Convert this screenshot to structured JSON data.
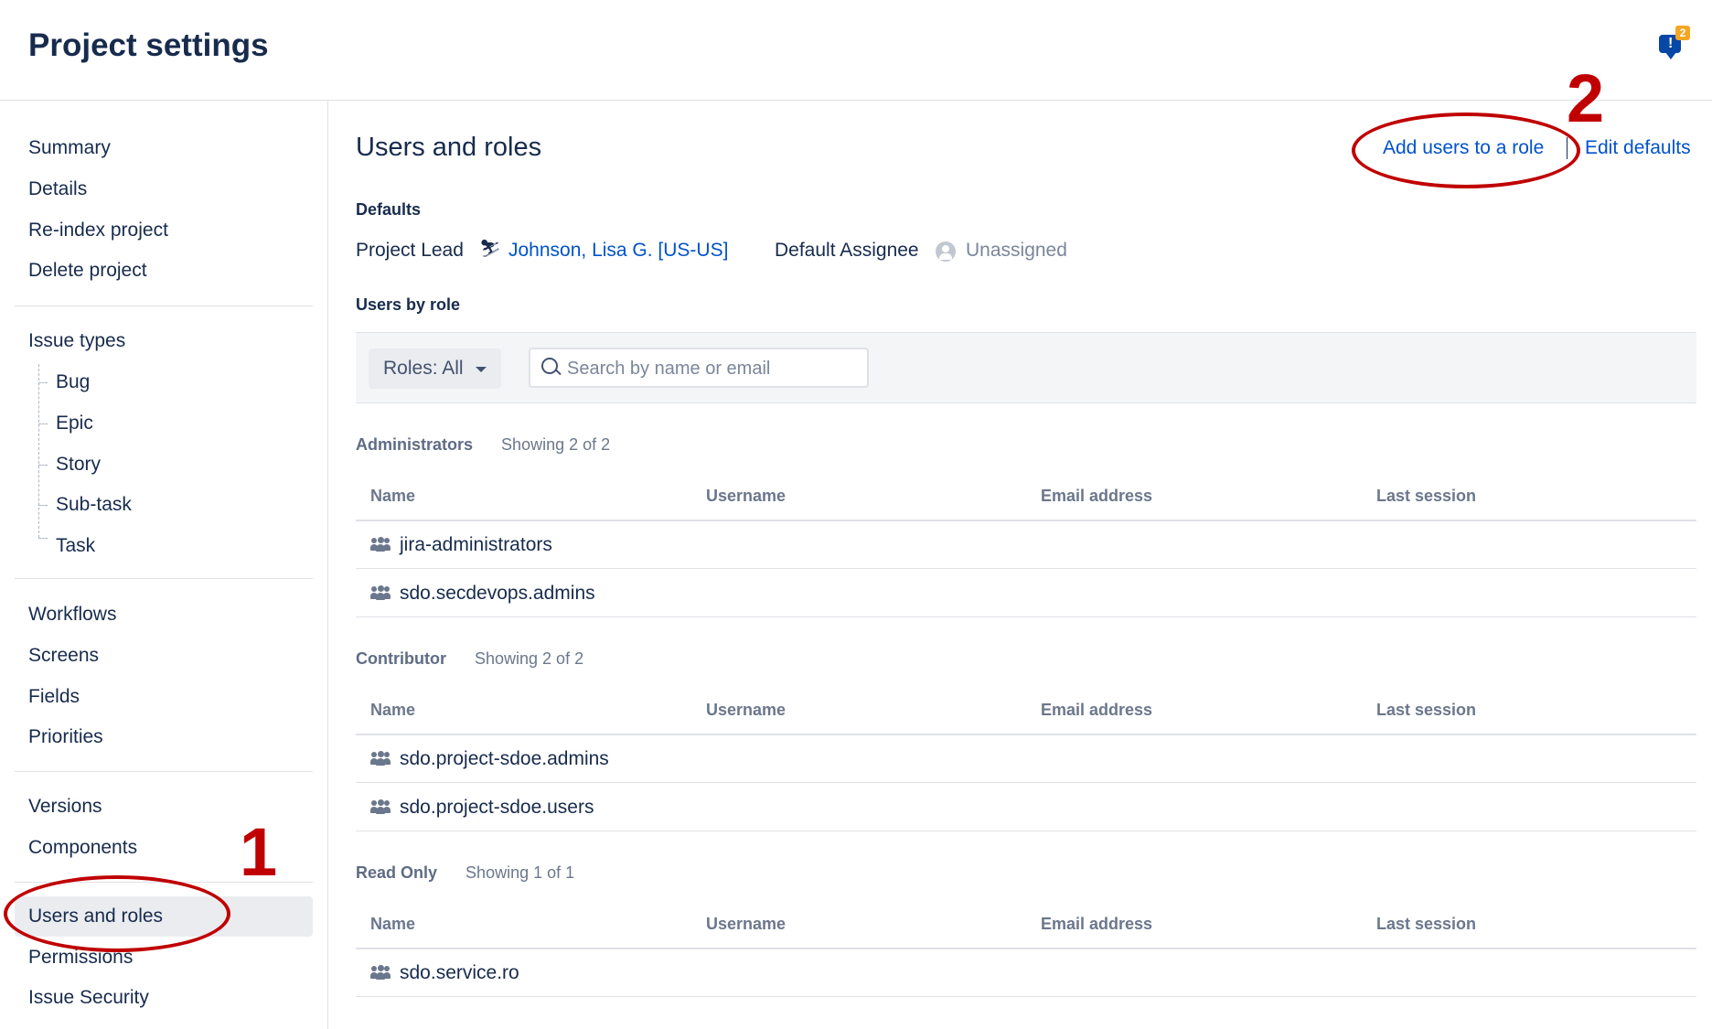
{
  "header": {
    "title": "Project settings",
    "feedback_badge": "2"
  },
  "sidebar": {
    "items": [
      {
        "label": "Summary"
      },
      {
        "label": "Details"
      },
      {
        "label": "Re-index project"
      },
      {
        "label": "Delete project"
      },
      {
        "label": "Issue types"
      },
      {
        "label": "Bug"
      },
      {
        "label": "Epic"
      },
      {
        "label": "Story"
      },
      {
        "label": "Sub-task"
      },
      {
        "label": "Task"
      },
      {
        "label": "Workflows"
      },
      {
        "label": "Screens"
      },
      {
        "label": "Fields"
      },
      {
        "label": "Priorities"
      },
      {
        "label": "Versions"
      },
      {
        "label": "Components"
      },
      {
        "label": "Users and roles",
        "active": true
      },
      {
        "label": "Permissions"
      },
      {
        "label": "Issue Security"
      }
    ]
  },
  "annotations": {
    "one": "1",
    "two": "2",
    "color": "#c00000"
  },
  "main": {
    "title": "Users and roles",
    "add_users_label": "Add users to a role",
    "edit_defaults_label": "Edit defaults",
    "defaults_heading": "Defaults",
    "project_lead_label": "Project Lead",
    "project_lead_value": "Johnson, Lisa G. [US-US]",
    "default_assignee_label": "Default Assignee",
    "default_assignee_value": "Unassigned",
    "users_by_role_heading": "Users by role",
    "roles_filter_label": "Roles: All",
    "search_placeholder": "Search by name or email",
    "columns": [
      "Name",
      "Username",
      "Email address",
      "Last session"
    ],
    "roles": [
      {
        "name": "Administrators",
        "showing": "Showing 2 of 2",
        "members": [
          "jira-administrators",
          "sdo.secdevops.admins"
        ]
      },
      {
        "name": "Contributor",
        "showing": "Showing 2 of 2",
        "members": [
          "sdo.project-sdoe.admins",
          "sdo.project-sdoe.users"
        ]
      },
      {
        "name": "Read Only",
        "showing": "Showing 1 of 1",
        "members": [
          "sdo.service.ro"
        ]
      }
    ]
  },
  "colors": {
    "link": "#0052cc",
    "text": "#172b4d",
    "muted": "#6b778c",
    "active_bg": "#ebecf0"
  }
}
